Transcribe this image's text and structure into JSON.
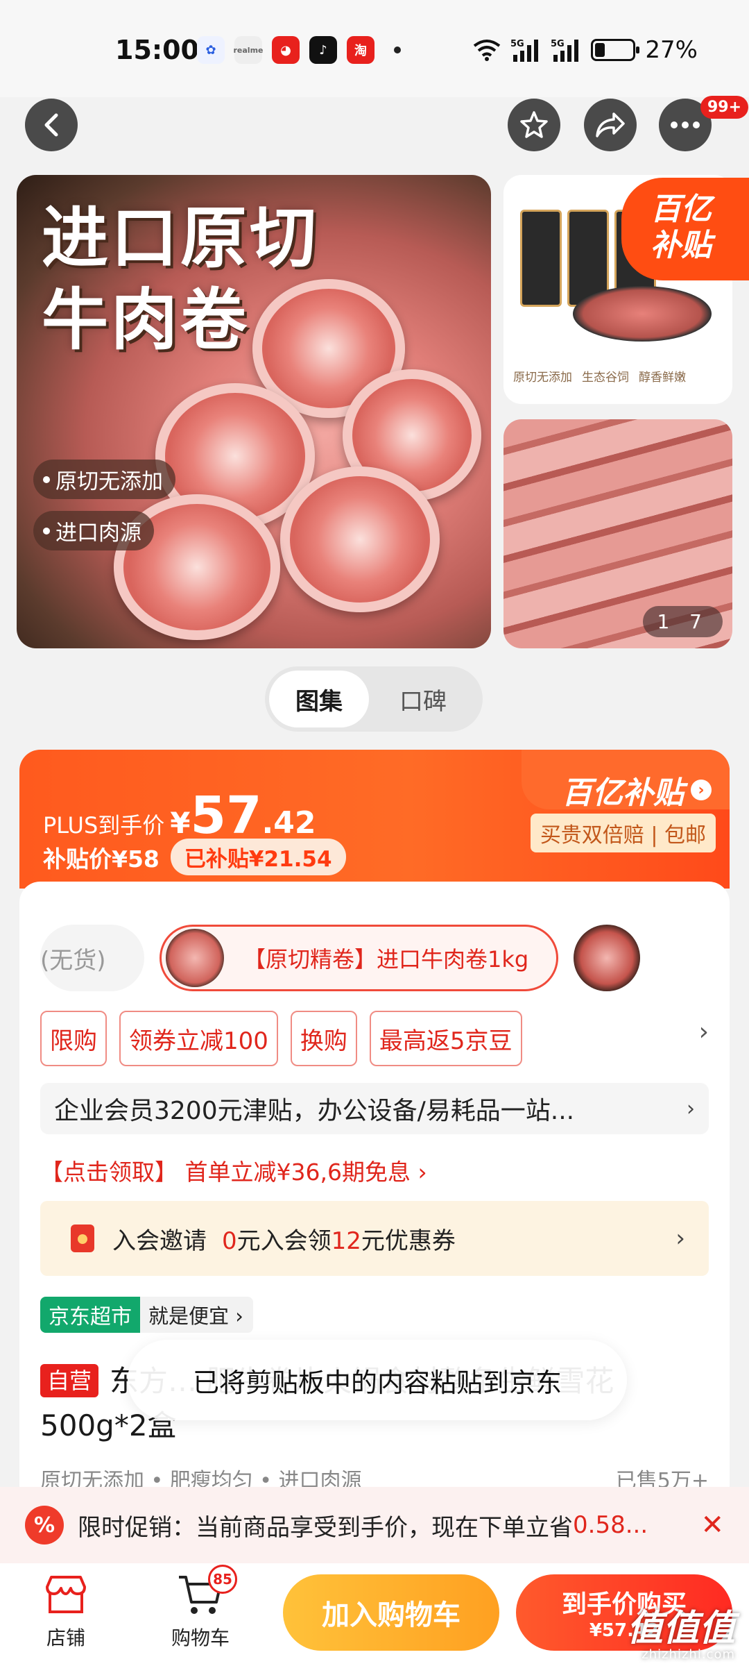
{
  "status_bar": {
    "time": "15:00",
    "apps": [
      {
        "icon": "baidu-icon",
        "color": "#2b5fe0"
      },
      {
        "icon": "realme-icon",
        "color": "#cccccc"
      },
      {
        "icon": "jd-dog-icon",
        "color": "#e8211d"
      },
      {
        "icon": "douyin-icon",
        "color": "#111111"
      },
      {
        "icon": "taobao-icon",
        "color": "#e8211d"
      }
    ],
    "network": "5G",
    "battery": "27%"
  },
  "nav": {
    "notif_badge": "99+"
  },
  "gallery": {
    "hero_title": [
      "进口原切",
      "牛肉卷"
    ],
    "hero_chips": [
      "原切无添加",
      "进口肉源"
    ],
    "thumb1_tags": [
      "原切无添加",
      "生态谷饲",
      "醇香鲜嫩"
    ],
    "subsidy_badge": [
      "百亿",
      "补贴"
    ],
    "counter": "1 7"
  },
  "segment": {
    "active": "图集",
    "inactive": "口碑"
  },
  "price": {
    "plus_label": "PLUS到手价",
    "currency": "¥",
    "amount_int": "57",
    "amount_dec": ".42",
    "subsidy_price": "补贴价¥58",
    "subsidized": "已补贴¥21.54",
    "program": "百亿补贴",
    "program_sub": "买贵双倍赔 | 包邮"
  },
  "skus": {
    "prev": "(无货)",
    "selected": "【原切精卷】进口牛肉卷1kg"
  },
  "promotions": [
    "限购",
    "领券立减100",
    "换购",
    "最高返5京豆"
  ],
  "corporate": "企业会员3200元津贴，办公设备/易耗品一站...",
  "coupon_line": "【点击领取】 首单立减¥36,6期免息 ›",
  "invite": {
    "label": "入会邀请",
    "zero": "0",
    "mid": "元入会领",
    "amount": "12",
    "tail": "元优惠券"
  },
  "store_tag": {
    "name": "京东超市",
    "slogan": "就是便宜 ›"
  },
  "product": {
    "self_operated": "自营",
    "title": "东方… 肥牛卷片火锅食材整条生鲜雪花500g*2盒",
    "meta_left": "原切无添加 • 肥瘦均匀 • 进口肉源",
    "meta_right": "已售5万+"
  },
  "toast": "已将剪贴板中的内容粘贴到京东",
  "flash": {
    "icon": "%",
    "text": "限时促销：当前商品享受到手价，现在下单立省",
    "amount": "0.58..."
  },
  "bottom_bar": {
    "store": "店铺",
    "cart": "购物车",
    "cart_count": "85",
    "add_to_cart": "加入购物车",
    "buy_label": "到手价购买",
    "buy_price": "¥57.42"
  },
  "watermark": {
    "logo": "值值值",
    "url": "zhizhizhi.com"
  }
}
